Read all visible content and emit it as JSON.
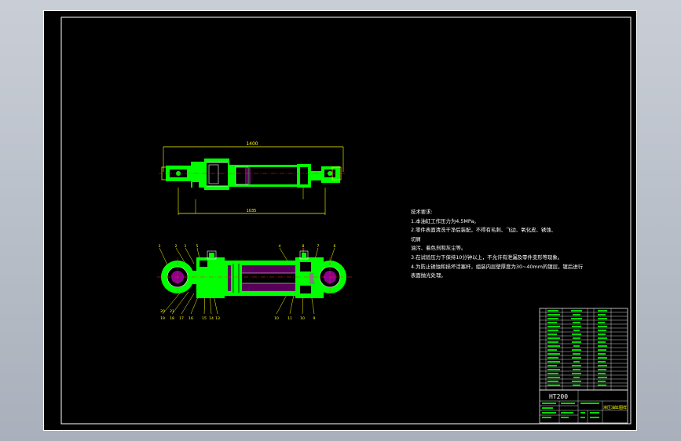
{
  "drawing": {
    "top_view": {
      "overall_dimension": "1400",
      "stroke_dimension": "1035"
    },
    "section_view": {
      "balloons_top": [
        "3",
        "2",
        "1",
        "5",
        "4",
        "8",
        "7",
        "6"
      ],
      "balloons_bottom_left": [
        "19",
        "18",
        "17",
        "16",
        "15",
        "14",
        "13",
        "12",
        "20",
        "21"
      ],
      "balloons_bottom_right": [
        "10",
        "11",
        "10",
        "9"
      ]
    }
  },
  "technical_notes": {
    "title": "技术要求:",
    "lines": [
      "1.本油缸工作压力为4.5MPa。",
      "2.零件表面清洗干净后装配，不得有毛刺、飞边、氧化皮、锈蚀、",
      "  切屑",
      "   油污、着色剂和灰尘等。",
      "3.在试验压力下保持10分钟以上，不允许有泄漏及零件变形等现象。",
      "4.为防止锈蚀和损坏活塞杆，组装内层壁厚度为30~40mm的镀层，镀后进行",
      "  表面抛光处理。"
    ]
  },
  "title_block": {
    "drawing_number": "HT200",
    "drawing_name": "液压油缸图样"
  },
  "colors": {
    "part_fill": "#00ff00",
    "outline": "#ffffff",
    "dimension": "#ffff00",
    "centerline": "#ff2020",
    "hatch": "#ff00ff"
  }
}
